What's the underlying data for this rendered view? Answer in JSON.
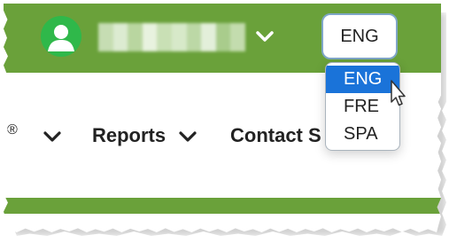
{
  "colors": {
    "brand_green": "#6aa13a",
    "selected_blue": "#1a73d9",
    "avatar_green": "#2fb84a"
  },
  "header": {
    "avatar_icon": "user-avatar-icon",
    "username_redacted": true,
    "user_menu_icon": "chevron-down-icon",
    "language_button_label": "ENG"
  },
  "language_menu": {
    "options": [
      "ENG",
      "FRE",
      "SPA"
    ],
    "selected": "ENG"
  },
  "nav": {
    "partial_item_suffix": "®",
    "partial_item_icon": "chevron-down-icon",
    "reports_label": "Reports",
    "reports_icon": "chevron-down-icon",
    "contact_label": "Contact S"
  },
  "cursor": {
    "type": "pointer-cursor-icon"
  }
}
